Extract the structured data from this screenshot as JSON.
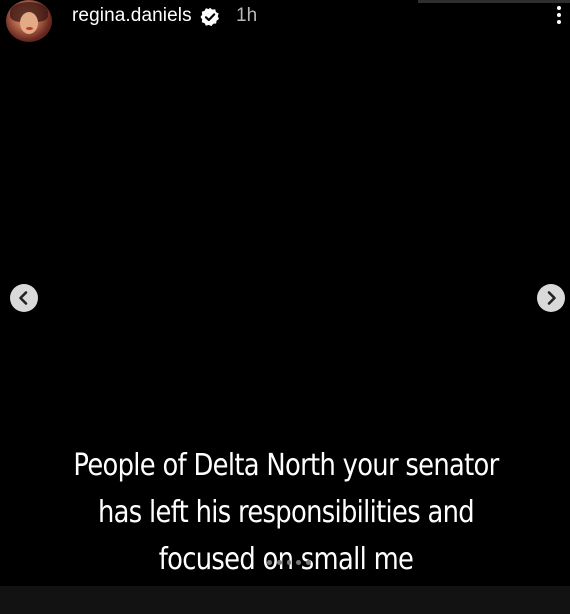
{
  "story": {
    "username": "regina.daniels",
    "time_ago": "1h",
    "verified": true,
    "caption_lines": [
      "People of Delta North your senator",
      "has left his responsibilities and",
      "focused on small me"
    ]
  },
  "icons": {
    "avatar": "profile-avatar",
    "verified": "verified-badge-icon",
    "more": "more-options-icon",
    "prev": "chevron-left-icon",
    "next": "chevron-right-icon"
  },
  "colors": {
    "background": "#000000",
    "text": "#ffffff",
    "muted": "#b8b8b8",
    "nav_button": "#d9d9d9"
  }
}
